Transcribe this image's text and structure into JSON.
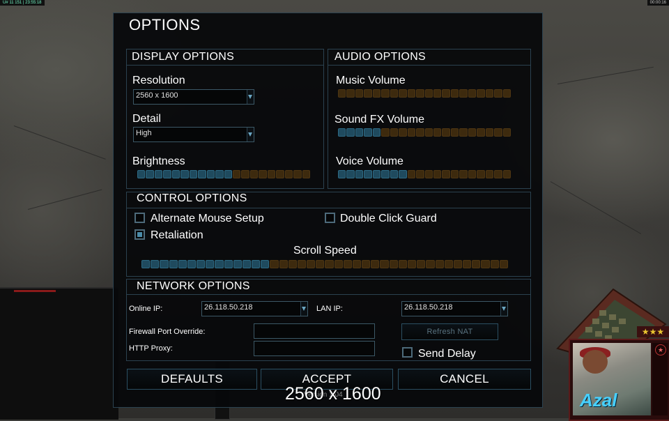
{
  "hud": {
    "top_left": "U# 11 151 | 23:55:18",
    "top_right": "00:00:16",
    "stars": "★★★",
    "portrait_name": "Azal"
  },
  "options": {
    "title": "OPTIONS",
    "display": {
      "heading": "DISPLAY OPTIONS",
      "resolution_label": "Resolution",
      "resolution_value": "2560 x 1600",
      "detail_label": "Detail",
      "detail_value": "High",
      "brightness_label": "Brightness",
      "brightness_level": 0.55
    },
    "audio": {
      "heading": "AUDIO OPTIONS",
      "music_label": "Music Volume",
      "music_level": 0,
      "sfx_label": "Sound FX Volume",
      "sfx_level": 0.25,
      "voice_label": "Voice Volume",
      "voice_level": 0.38
    },
    "control": {
      "heading": "CONTROL OPTIONS",
      "alt_mouse_label": "Alternate Mouse Setup",
      "alt_mouse_checked": false,
      "double_click_label": "Double Click Guard",
      "double_click_checked": false,
      "retaliation_label": "Retaliation",
      "retaliation_checked": true,
      "scroll_label": "Scroll Speed",
      "scroll_level": 0.35
    },
    "network": {
      "heading": "NETWORK OPTIONS",
      "online_ip_label": "Online IP:",
      "online_ip_value": "26.118.50.218",
      "lan_ip_label": "LAN IP:",
      "lan_ip_value": "26.118.50.218",
      "firewall_label": "Firewall Port Override:",
      "firewall_value": "",
      "proxy_label": "HTTP Proxy:",
      "proxy_value": "",
      "refresh_nat_label": "Refresh NAT",
      "send_delay_label": "Send Delay",
      "send_delay_checked": false
    },
    "buttons": {
      "defaults": "DEFAULTS",
      "accept": "ACCEPT",
      "cancel": "CANCEL"
    },
    "version": "Version 1.04"
  },
  "overlay_text": "2560 x 1600"
}
